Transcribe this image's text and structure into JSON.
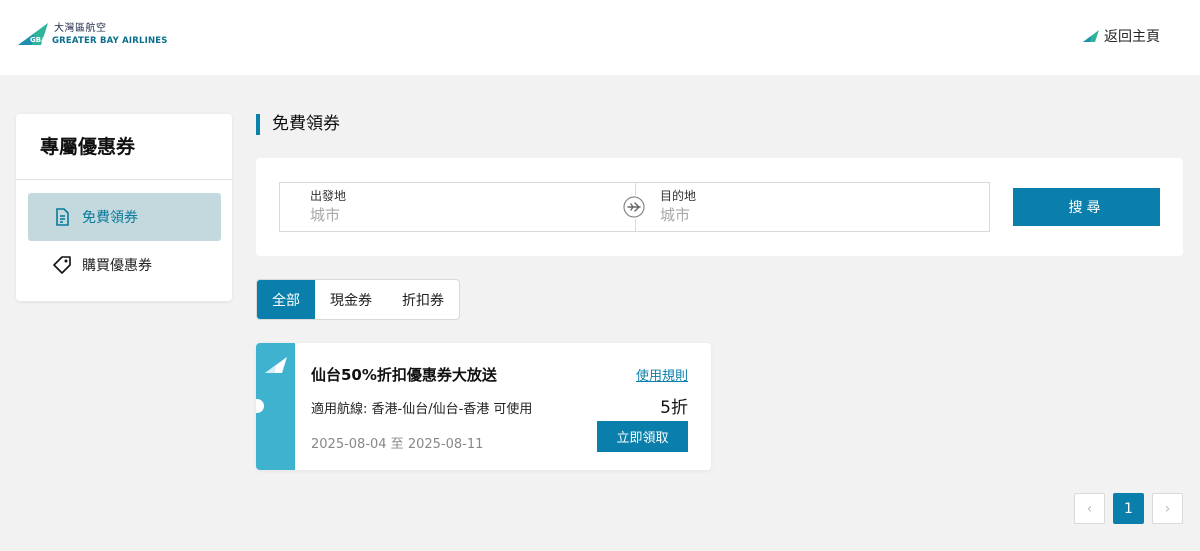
{
  "header": {
    "logo_cn": "大灣區航空",
    "logo_en": "GREATER BAY AIRLINES",
    "home_link": "返回主頁"
  },
  "sidebar": {
    "title": "專屬優惠券",
    "items": [
      {
        "label": "免費領券",
        "icon": "document-icon",
        "active": true
      },
      {
        "label": "購買優惠券",
        "icon": "tag-icon",
        "active": false
      }
    ]
  },
  "main": {
    "section_title": "免費領券",
    "search": {
      "origin_label": "出發地",
      "origin_placeholder": "城市",
      "origin_value": "",
      "destination_label": "目的地",
      "destination_placeholder": "城市",
      "destination_value": "",
      "button_label": "搜尋"
    },
    "tabs": [
      {
        "label": "全部",
        "active": true
      },
      {
        "label": "現金券",
        "active": false
      },
      {
        "label": "折扣券",
        "active": false
      }
    ],
    "coupons": [
      {
        "title": "仙台50%折扣優惠券大放送",
        "route": "適用航線:  香港-仙台/仙台-香港 可使用",
        "dates": "2025-08-04 至 2025-08-11",
        "rules_label": "使用規則",
        "discount": "5折",
        "claim_label": "立即領取"
      }
    ],
    "pagination": {
      "prev_icon": "‹",
      "current_page": "1",
      "next_icon": "›"
    }
  },
  "colors": {
    "accent": "#0a7fab",
    "stub": "#3fb2cf",
    "active_bg": "#c3d9de",
    "background": "#f2f2f2"
  }
}
